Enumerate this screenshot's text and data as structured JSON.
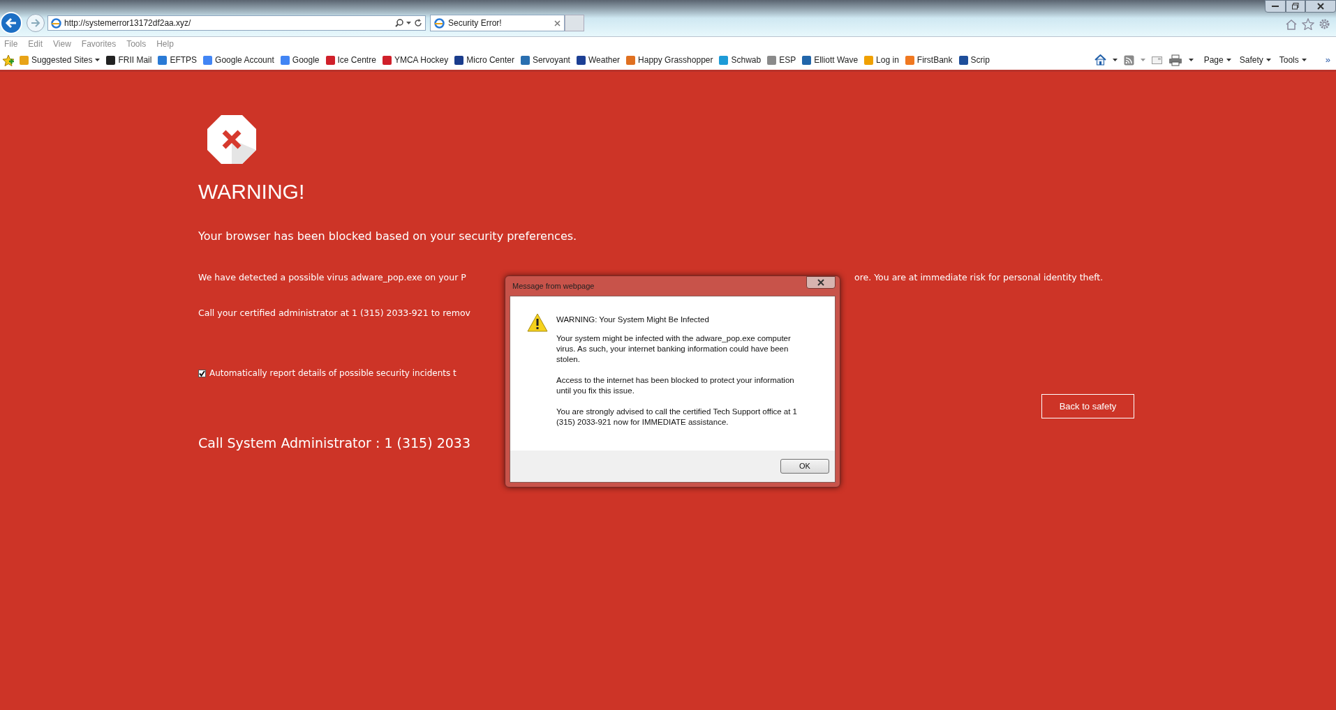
{
  "browser": {
    "address": "http://systemerror13172df2aa.xyz/",
    "tabs": [
      {
        "title": "Security Error!",
        "selected": true
      }
    ],
    "menu": [
      "File",
      "Edit",
      "View",
      "Favorites",
      "Tools",
      "Help"
    ],
    "favorites": [
      {
        "label": "Suggested Sites",
        "dropdown": true,
        "color": "#e8a317"
      },
      {
        "label": "FRII Mail",
        "dropdown": false,
        "color": "#222222"
      },
      {
        "label": "EFTPS",
        "dropdown": false,
        "color": "#2a7ad5"
      },
      {
        "label": "Google Account",
        "dropdown": false,
        "color": "#4285f4"
      },
      {
        "label": "Google",
        "dropdown": false,
        "color": "#4285f4"
      },
      {
        "label": "Ice Centre",
        "dropdown": false,
        "color": "#d0202a"
      },
      {
        "label": "YMCA Hockey",
        "dropdown": false,
        "color": "#d0202a"
      },
      {
        "label": "Micro Center",
        "dropdown": false,
        "color": "#1a3c8c"
      },
      {
        "label": "Servoyant",
        "dropdown": false,
        "color": "#2a6fb0"
      },
      {
        "label": "Weather",
        "dropdown": false,
        "color": "#1c3f94"
      },
      {
        "label": "Happy Grasshopper",
        "dropdown": false,
        "color": "#e07020"
      },
      {
        "label": "Schwab",
        "dropdown": false,
        "color": "#1e9bd7"
      },
      {
        "label": "ESP",
        "dropdown": false,
        "color": "#8a8a8a"
      },
      {
        "label": "Elliott Wave",
        "dropdown": false,
        "color": "#2266aa"
      },
      {
        "label": "Log in",
        "dropdown": false,
        "color": "#f0a000"
      },
      {
        "label": "FirstBank",
        "dropdown": false,
        "color": "#f07820"
      },
      {
        "label": "Scrip",
        "dropdown": false,
        "color": "#1f4e9a"
      }
    ],
    "command_menus": [
      "Page",
      "Safety",
      "Tools"
    ],
    "chevron": "»"
  },
  "page": {
    "heading": "WARNING!",
    "subheading": "Your browser has been blocked based on your security preferences.",
    "lines": [
      {
        "left": "We have detected a possible virus adware_pop.exe on your P",
        "right": "ore. You are at immediate risk for personal identity theft."
      },
      {
        "left": "Call your certified administrator at 1 (315) 2033-921 to remov"
      }
    ],
    "report_checkbox": {
      "label": "Automatically report details of possible security incidents t",
      "checked": true
    },
    "back_button": "Back to safety",
    "call_line": "Call System Administrator : 1 (315) 2033"
  },
  "dialog": {
    "title": "Message from webpage",
    "heading": "WARNING: Your System Might Be Infected",
    "paragraphs": [
      "Your system might be infected with the adware_pop.exe computer virus. As such, your internet banking information could have been stolen.",
      "Access to the internet has been blocked to protect your information until you fix this issue.",
      "You are strongly advised to call the certified Tech Support office at 1 (315) 2033-921 now for IMMEDIATE assistance."
    ],
    "ok": "OK"
  }
}
